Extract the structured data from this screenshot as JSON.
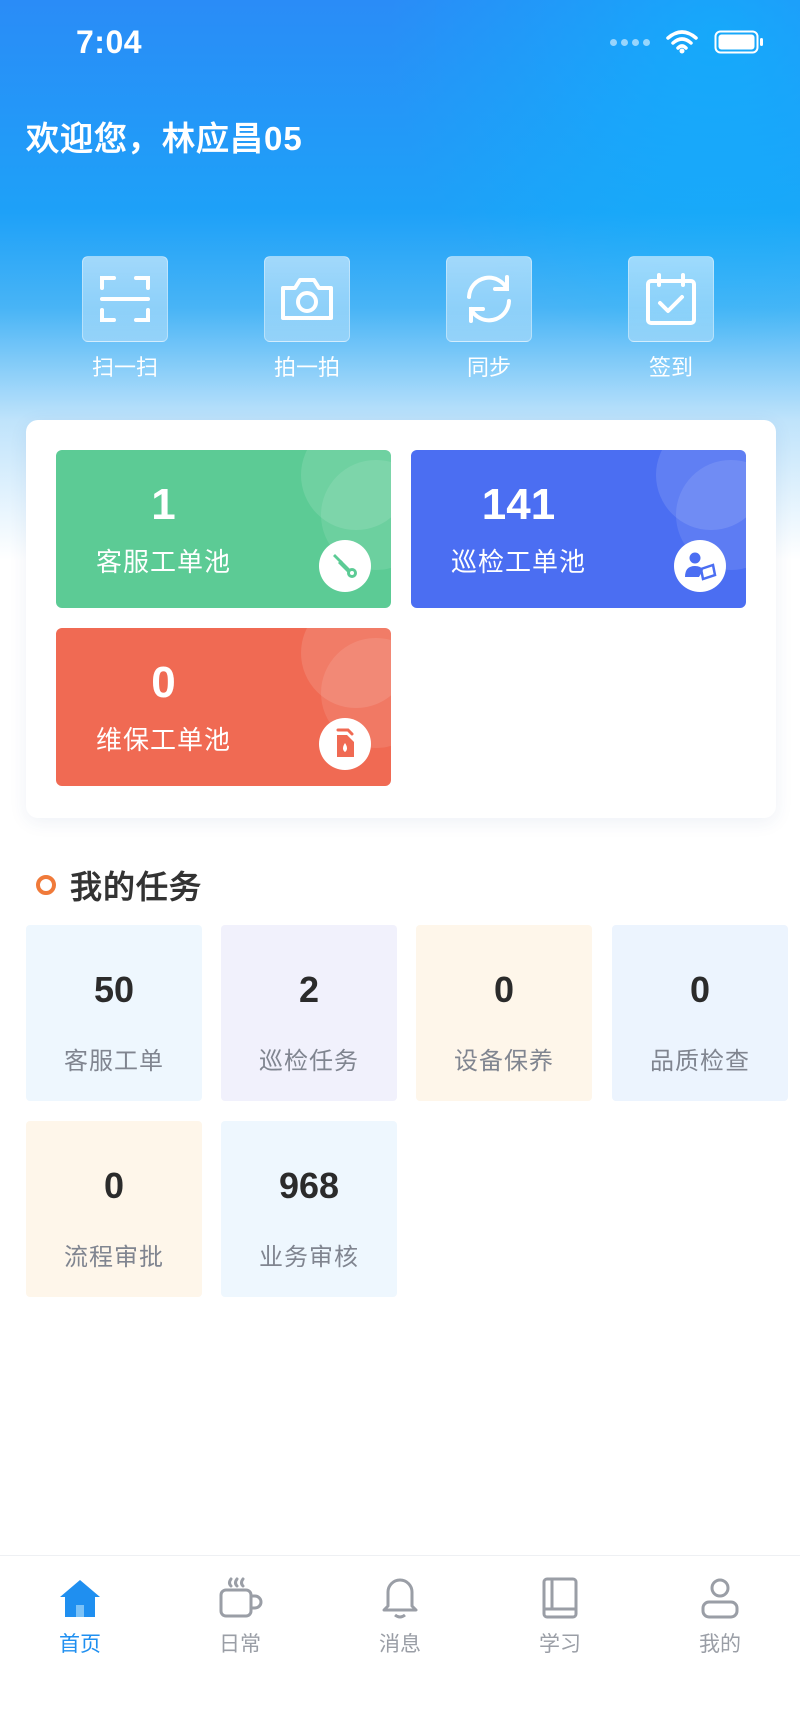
{
  "status_bar": {
    "time": "7:04"
  },
  "header": {
    "welcome": "欢迎您，林应昌05"
  },
  "quick_actions": [
    {
      "label": "扫一扫",
      "icon": "scan-icon"
    },
    {
      "label": "拍一拍",
      "icon": "camera-icon"
    },
    {
      "label": "同步",
      "icon": "sync-icon"
    },
    {
      "label": "签到",
      "icon": "checkin-icon"
    }
  ],
  "pools": [
    {
      "count": "1",
      "label": "客服工单池",
      "color": "#5ccb95",
      "icon": "wrench-icon"
    },
    {
      "count": "141",
      "label": "巡检工单池",
      "color": "#4b6ef2",
      "icon": "inspector-icon"
    },
    {
      "count": "0",
      "label": "维保工单池",
      "color": "#f06a53",
      "icon": "oil-can-icon"
    }
  ],
  "tasks_section": {
    "title": "我的任务",
    "dot_color": "#f07a3a"
  },
  "tasks": [
    {
      "count": "50",
      "label": "客服工单",
      "bg": "#eef7fe"
    },
    {
      "count": "2",
      "label": "巡检任务",
      "bg": "#f1f1fc"
    },
    {
      "count": "0",
      "label": "设备保养",
      "bg": "#fef6ea"
    },
    {
      "count": "0",
      "label": "品质检查",
      "bg": "#ecf4fe"
    },
    {
      "count": "0",
      "label": "流程审批",
      "bg": "#fef6ea"
    },
    {
      "count": "968",
      "label": "业务审核",
      "bg": "#eef7fe"
    }
  ],
  "tabbar": {
    "active": 0,
    "accent": "#1f8ff0",
    "items": [
      {
        "label": "首页",
        "icon": "home-icon"
      },
      {
        "label": "日常",
        "icon": "coffee-cup-icon"
      },
      {
        "label": "消息",
        "icon": "bell-icon"
      },
      {
        "label": "学习",
        "icon": "book-icon"
      },
      {
        "label": "我的",
        "icon": "user-icon"
      }
    ]
  }
}
